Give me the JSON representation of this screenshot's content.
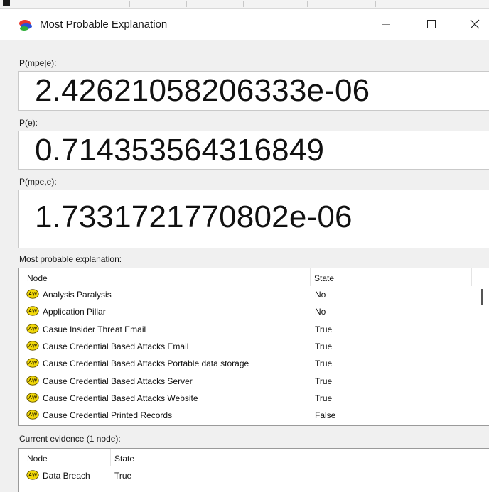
{
  "window": {
    "title": "Most Probable Explanation",
    "min_glyph": "—",
    "close_glyph": "✕"
  },
  "sections": {
    "p_mpe_given_e": {
      "label": "P(mpe|e):",
      "value": "2.42621058206333e-06"
    },
    "p_e": {
      "label": "P(e):",
      "value": "0.714353564316849"
    },
    "p_mpe_and_e": {
      "label": "P(mpe,e):",
      "value": "1.7331721770802e-06"
    }
  },
  "mpe_list": {
    "label": "Most probable explanation:",
    "headers": {
      "node": "Node",
      "state": "State"
    },
    "icon": "bayes-node-icon",
    "rows": [
      {
        "node": "Analysis Paralysis",
        "state": "No"
      },
      {
        "node": "Application Pillar",
        "state": "No"
      },
      {
        "node": "Casue Insider Threat Email",
        "state": "True"
      },
      {
        "node": "Cause Credential Based Attacks Email",
        "state": "True"
      },
      {
        "node": "Cause Credential Based Attacks Portable data storage",
        "state": "True"
      },
      {
        "node": "Cause Credential Based Attacks Server",
        "state": "True"
      },
      {
        "node": "Cause Credential Based Attacks Website",
        "state": "True"
      },
      {
        "node": "Cause Credential Printed Records",
        "state": "False"
      }
    ]
  },
  "evidence_list": {
    "label": "Current evidence (1 node):",
    "headers": {
      "node": "Node",
      "state": "State"
    },
    "rows": [
      {
        "node": "Data Breach",
        "state": "True"
      }
    ]
  },
  "colors": {
    "icon_yellow": "#f2d90a",
    "icon_outline": "#6b5a00",
    "app_icon_red": "#e8342a",
    "app_icon_blue": "#2a50d8",
    "app_icon_green": "#2fae3a"
  }
}
